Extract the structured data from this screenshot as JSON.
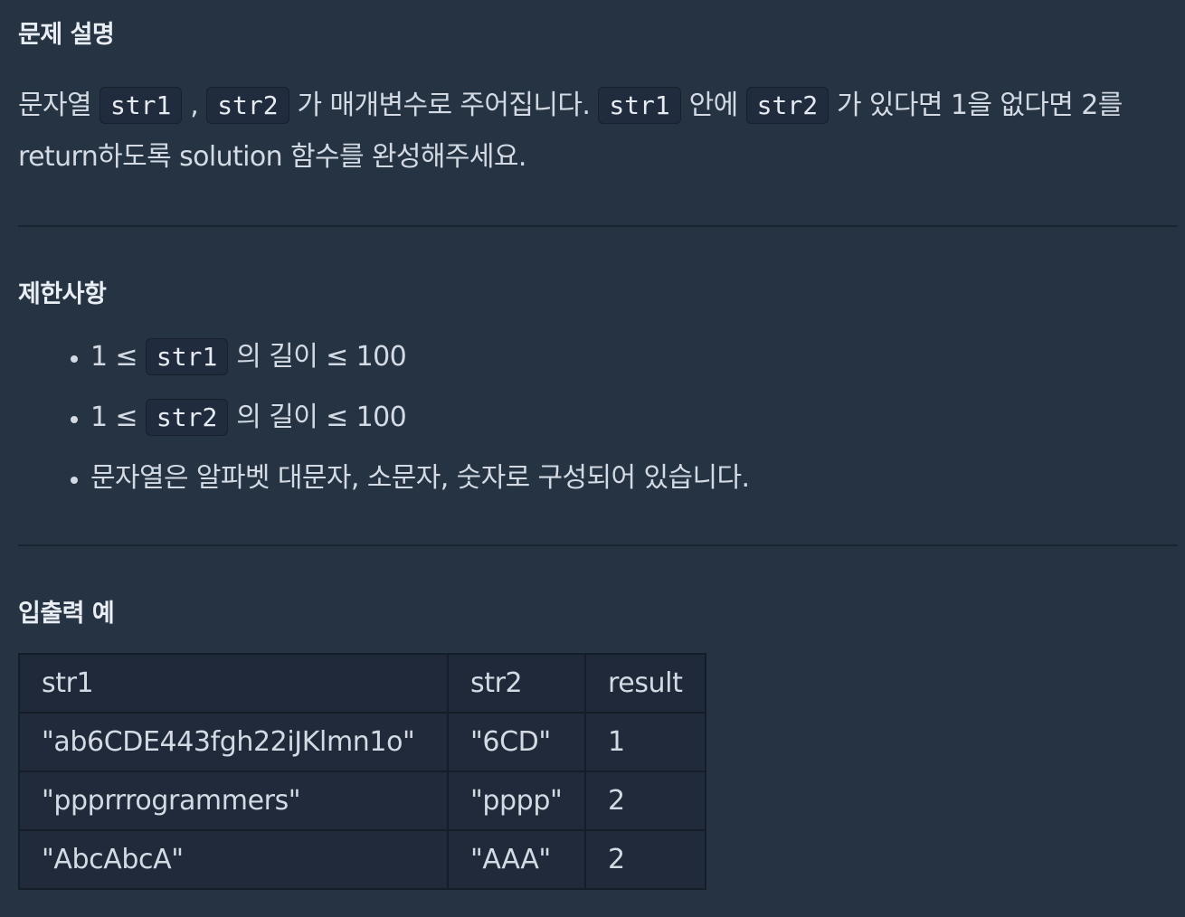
{
  "sections": {
    "description_title": "문제 설명",
    "constraints_title": "제한사항",
    "examples_title": "입출력 예"
  },
  "description": {
    "t1": "문자열 ",
    "c1": "str1",
    "t2": " , ",
    "c2": "str2",
    "t3": " 가 매개변수로 주어집니다. ",
    "c3": "str1",
    "t4": " 안에 ",
    "c4": "str2",
    "t5": " 가 있다면 1을 없다면 2를 return하도록 solution 함수를 완성해주세요."
  },
  "constraints": [
    {
      "pre": "1 ≤ ",
      "code": "str1",
      "post": " 의 길이 ≤ 100"
    },
    {
      "pre": "1 ≤ ",
      "code": "str2",
      "post": " 의 길이 ≤ 100"
    },
    {
      "text": "문자열은 알파벳 대문자, 소문자, 숫자로 구성되어 있습니다."
    }
  ],
  "examples_table": {
    "headers": [
      "str1",
      "str2",
      "result"
    ],
    "rows": [
      [
        "\"ab6CDE443fgh22iJKlmn1o\"",
        "\"6CD\"",
        "1"
      ],
      [
        "\"ppprrrogrammers\"",
        "\"pppp\"",
        "2"
      ],
      [
        "\"AbcAbcA\"",
        "\"AAA\"",
        "2"
      ]
    ]
  },
  "colors": {
    "background": "#263343",
    "text": "#d3dae3",
    "code_background": "#202b3d",
    "table_border": "#151d29"
  }
}
